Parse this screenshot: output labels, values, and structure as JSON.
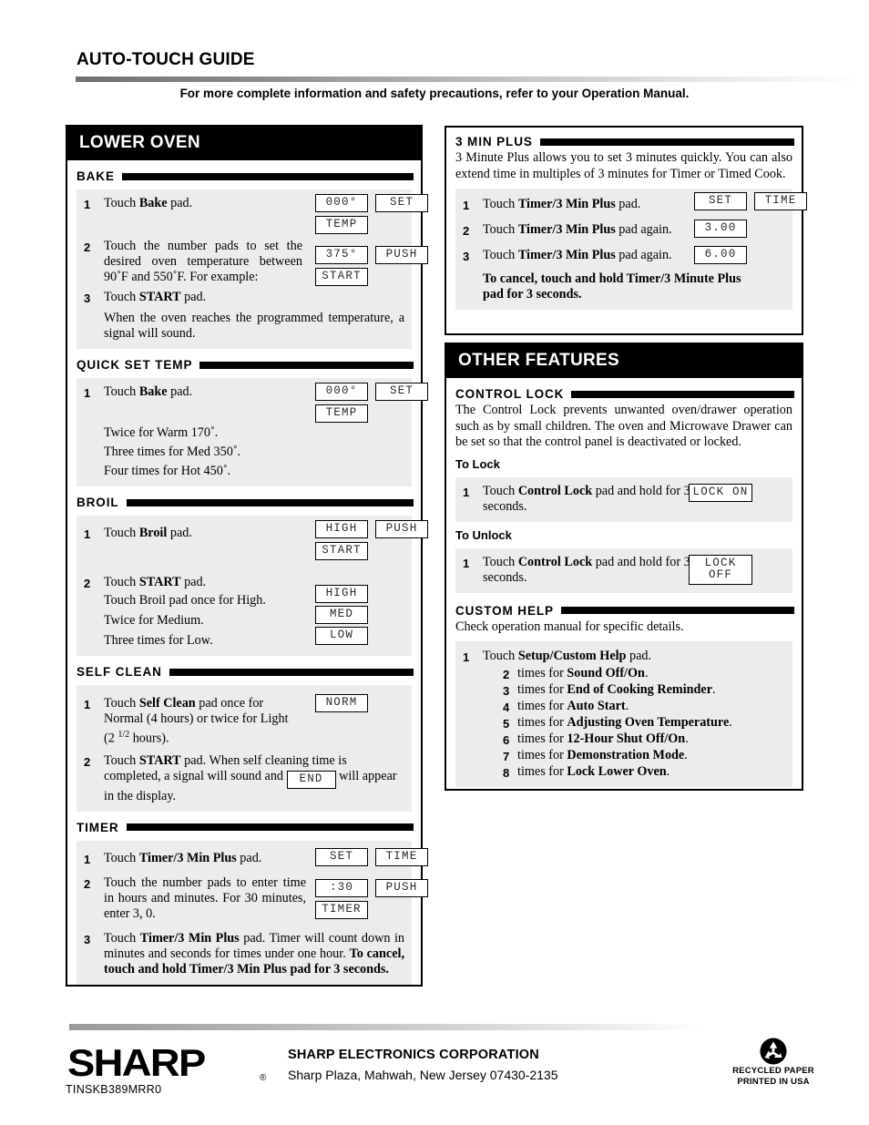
{
  "header": {
    "title": "AUTO-TOUCH GUIDE",
    "note": "For more complete information and safety precautions, refer to your Operation Manual."
  },
  "lower_oven": {
    "banner": "LOWER OVEN",
    "bake": {
      "heading": "BAKE",
      "step1_num": "1",
      "step1_pre": "Touch ",
      "step1_bold": "Bake",
      "step1_post": " pad.",
      "step1_lcd": [
        "000°",
        "SET",
        "TEMP"
      ],
      "step2_num": "2",
      "step2_text": "Touch the number pads to set the desired oven temperature between 90˚F and 550˚F. For example:",
      "step2_lcd": [
        "375°",
        "PUSH",
        "START"
      ],
      "step3_num": "3",
      "step3_pre": "Touch ",
      "step3_bold": "START",
      "step3_post": " pad.",
      "note": "When the oven reaches the programmed temperature, a signal will sound."
    },
    "quick_set_temp": {
      "heading": "QUICK SET TEMP",
      "step1_num": "1",
      "step1_pre": "Touch ",
      "step1_bold": "Bake",
      "step1_post": " pad.",
      "step1_lcd": [
        "000°",
        "SET",
        "TEMP"
      ],
      "line1": "Twice for Warm 170˚.",
      "line2": "Three times for Med 350˚.",
      "line3": "Four times for Hot 450˚."
    },
    "broil": {
      "heading": "BROIL",
      "step1_num": "1",
      "step1_pre": "Touch ",
      "step1_bold": "Broil",
      "step1_post": " pad.",
      "step1_lcd": [
        "HIGH",
        "PUSH",
        "START"
      ],
      "step2_num": "2",
      "step2_pre": "Touch ",
      "step2_bold": "START",
      "step2_post": " pad.",
      "line1": "Touch Broil pad once for High.",
      "line1_lcd": "HIGH",
      "line2": "Twice for Medium.",
      "line2_lcd": "MED",
      "line3": "Three times for Low.",
      "line3_lcd": "LOW"
    },
    "self_clean": {
      "heading": "SELF CLEAN",
      "step1_num": "1",
      "step1_pre": "Touch ",
      "step1_bold": "Self Clean",
      "step1_post": " pad once for Normal (4 hours) or twice for Light (2 ",
      "step1_frac": "1/2",
      "step1_end": " hours).",
      "step1_lcd": "NORM",
      "step2_num": "2",
      "step2_pre": "Touch ",
      "step2_bold": "START",
      "step2_mid": " pad. When self cleaning time is completed, a signal will sound and ",
      "step2_lcd": "END",
      "step2_post": " will appear in the display."
    },
    "timer": {
      "heading": "TIMER",
      "step1_num": "1",
      "step1_pre": "Touch ",
      "step1_bold": "Timer/3 Min Plus",
      "step1_post": " pad.",
      "step1_lcd": [
        "SET",
        "TIME"
      ],
      "step2_num": "2",
      "step2_text": "Touch the number pads to enter time in hours and minutes. For 30 minutes, enter 3, 0.",
      "step2_lcd": [
        ":30",
        "PUSH",
        "TIMER"
      ],
      "step3_num": "3",
      "step3_pre": "Touch ",
      "step3_bold": "Timer/3 Min Plus",
      "step3_mid": " pad. Timer will count down in minutes and seconds for times under one hour. ",
      "step3_bold2": "To cancel, touch and hold Timer/3 Min Plus pad for 3 seconds."
    }
  },
  "three_min_plus": {
    "heading": "3 MIN PLUS",
    "description": "3 Minute Plus allows you to set 3 minutes quickly. You can also extend time in multiples of 3 minutes for Timer or Timed Cook.",
    "step1_num": "1",
    "step1_pre": "Touch ",
    "step1_bold": "Timer/3 Min Plus",
    "step1_post": " pad.",
    "step1_lcd": [
      "SET",
      "TIME"
    ],
    "step2_num": "2",
    "step2_pre": "Touch ",
    "step2_bold": "Timer/3 Min Plus",
    "step2_post": " pad again.",
    "step2_lcd": "3.00",
    "step3_num": "3",
    "step3_pre": "Touch ",
    "step3_bold": "Timer/3 Min Plus",
    "step3_post": " pad again.",
    "step3_lcd": "6.00",
    "cancel_note": "To cancel, touch and hold Timer/3 Minute Plus pad for 3 seconds."
  },
  "other_features": {
    "banner": "OTHER FEATURES",
    "control_lock": {
      "heading": "CONTROL LOCK",
      "description": "The Control Lock prevents unwanted oven/drawer operation such as by small children. The oven and Microwave Drawer can be set so that the control panel is deactivated or locked.",
      "to_lock_label": "To Lock",
      "lock_num": "1",
      "lock_pre": "Touch ",
      "lock_bold": "Control Lock",
      "lock_post": " pad and hold for 3 seconds.",
      "lock_lcd": "LOCK ON",
      "to_unlock_label": "To Unlock",
      "unlock_num": "1",
      "unlock_pre": "Touch ",
      "unlock_bold": "Control Lock",
      "unlock_post": " pad and hold for 3 seconds.",
      "unlock_lcd": "LOCK OFF"
    },
    "custom_help": {
      "heading": "CUSTOM HELP",
      "description": "Check operation manual for specific details.",
      "step1_num": "1",
      "step1_pre": "Touch ",
      "step1_bold": "Setup/Custom Help",
      "step1_post": " pad.",
      "items": [
        {
          "num": "2",
          "mid": " times for ",
          "bold": "Sound Off/On",
          "end": "."
        },
        {
          "num": "3",
          "mid": " times for ",
          "bold": "End of Cooking Reminder",
          "end": "."
        },
        {
          "num": "4",
          "mid": " times for ",
          "bold": "Auto Start",
          "end": "."
        },
        {
          "num": "5",
          "mid": " times for ",
          "bold": "Adjusting Oven Temperature",
          "end": "."
        },
        {
          "num": "6",
          "mid": " times for ",
          "bold": "12-Hour Shut Off/On",
          "end": "."
        },
        {
          "num": "7",
          "mid": " times for ",
          "bold": "Demonstration Mode",
          "end": "."
        },
        {
          "num": "8",
          "mid": " times for ",
          "bold": "Lock Lower Oven",
          "end": "."
        }
      ]
    }
  },
  "footer": {
    "logo": "SHARP",
    "registered": "®",
    "model_code": "TINSKB389MRR0",
    "corp_name": "SHARP ELECTRONICS CORPORATION",
    "corp_address": "Sharp Plaza, Mahwah, New Jersey 07430-2135",
    "recycle_line1": "RECYCLED PAPER",
    "recycle_line2": "PRINTED IN USA"
  }
}
